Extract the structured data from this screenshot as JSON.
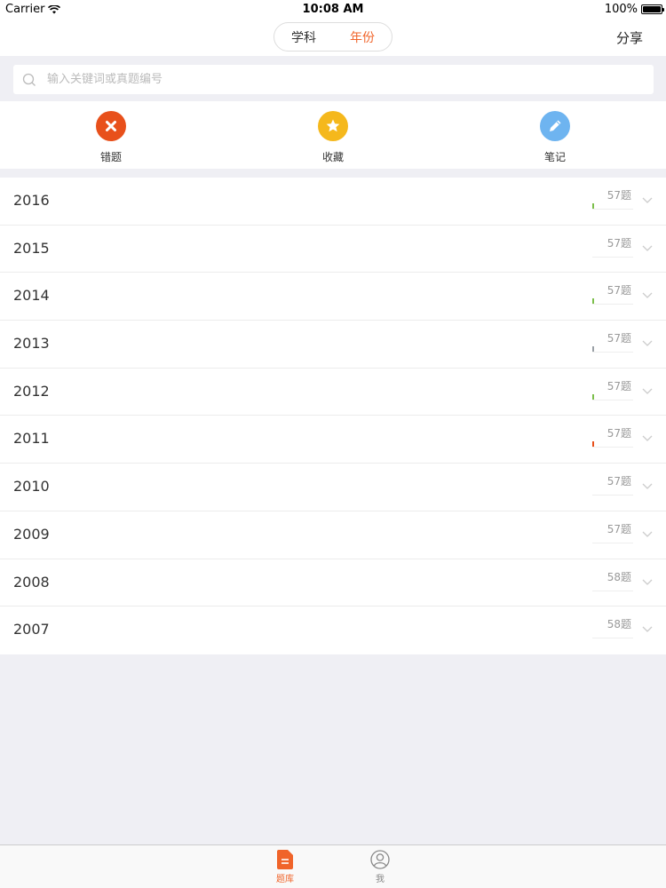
{
  "status_bar": {
    "carrier": "Carrier",
    "time": "10:08 AM",
    "battery": "100%"
  },
  "nav": {
    "segments": [
      "学科",
      "年份"
    ],
    "selected_segment": "年份",
    "share_label": "分享"
  },
  "search": {
    "placeholder": "输入关键词或真题编号",
    "value": ""
  },
  "quick_actions": [
    {
      "label": "错题",
      "icon": "close-icon",
      "color": "#e8501b"
    },
    {
      "label": "收藏",
      "icon": "star-icon",
      "color": "#f5b81c"
    },
    {
      "label": "笔记",
      "icon": "pencil-icon",
      "color": "#6eb4f0"
    }
  ],
  "years": [
    {
      "year": "2016",
      "count": "57题",
      "progress_fraction": 0.04,
      "progress_color": "#7cbf4b"
    },
    {
      "year": "2015",
      "count": "57题",
      "progress_fraction": 0.0,
      "progress_color": "#7cbf4b"
    },
    {
      "year": "2014",
      "count": "57题",
      "progress_fraction": 0.04,
      "progress_color": "#7cbf4b"
    },
    {
      "year": "2013",
      "count": "57题",
      "progress_fraction": 0.04,
      "progress_color": "#9aa0a6"
    },
    {
      "year": "2012",
      "count": "57题",
      "progress_fraction": 0.04,
      "progress_color": "#7cbf4b"
    },
    {
      "year": "2011",
      "count": "57题",
      "progress_fraction": 0.04,
      "progress_color": "#e8501b"
    },
    {
      "year": "2010",
      "count": "57题",
      "progress_fraction": 0.0,
      "progress_color": "#7cbf4b"
    },
    {
      "year": "2009",
      "count": "57题",
      "progress_fraction": 0.0,
      "progress_color": "#7cbf4b"
    },
    {
      "year": "2008",
      "count": "58题",
      "progress_fraction": 0.0,
      "progress_color": "#7cbf4b"
    },
    {
      "year": "2007",
      "count": "58题",
      "progress_fraction": 0.0,
      "progress_color": "#7cbf4b"
    }
  ],
  "tabs": [
    {
      "label": "题库",
      "icon": "document-icon",
      "active": true
    },
    {
      "label": "我",
      "icon": "user-icon",
      "active": false
    }
  ],
  "colors": {
    "accent": "#f0642a"
  }
}
